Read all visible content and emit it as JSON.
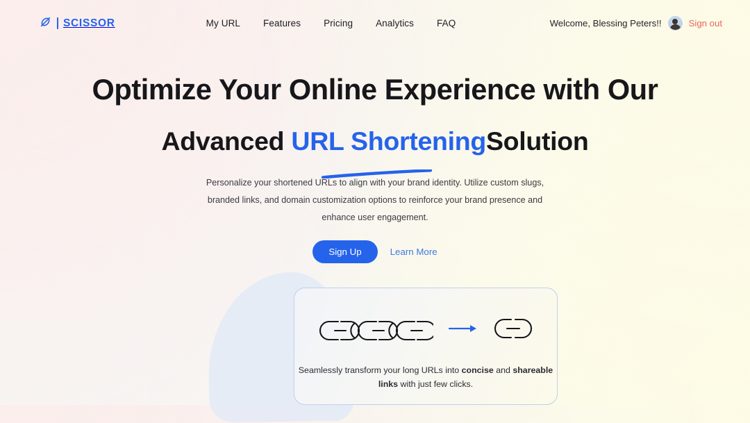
{
  "brand": {
    "name": "SCISSOR",
    "logo_icon": "scissor-leaf-icon",
    "accent_color": "#2563eb"
  },
  "nav": {
    "items": [
      {
        "label": "My URL"
      },
      {
        "label": "Features"
      },
      {
        "label": "Pricing"
      },
      {
        "label": "Analytics"
      },
      {
        "label": "FAQ"
      }
    ]
  },
  "user": {
    "welcome_text": "Welcome, Blessing Peters!!",
    "avatar_icon": "user-avatar",
    "sign_out_label": "Sign out",
    "sign_out_color": "#e8685f"
  },
  "hero": {
    "headline_line1": "Optimize Your Online Experience with Our",
    "headline_line2_pre": "Advanced ",
    "headline_line2_accent": "URL Shortening",
    "headline_line2_post": "Solution",
    "subcopy": "Personalize your shortened URLs to align with your brand identity. Utilize custom slugs, branded links, and domain customization options to reinforce your brand presence and enhance user engagement.",
    "primary_cta": "Sign Up",
    "secondary_cta": "Learn More",
    "primary_cta_color": "#2563eb"
  },
  "promo_card": {
    "long_link_icon": "chain-links-long-icon",
    "arrow_icon": "arrow-right-icon",
    "short_link_icon": "chain-link-short-icon",
    "caption_part1": "Seamlessly transform your long URLs into ",
    "caption_bold1": "concise",
    "caption_part2": " and ",
    "caption_bold2": "shareable links",
    "caption_part3": " with just few clicks.",
    "border_color": "#bfd0ec",
    "arrow_color": "#2563eb"
  }
}
